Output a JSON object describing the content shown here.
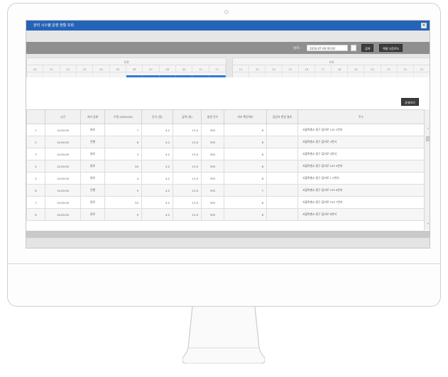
{
  "window": {
    "title": "관리 시스템 운영 현황 조회",
    "close_label": "×"
  },
  "toolbar": {
    "date_label": "일자 :",
    "date_value": "2016-07-00 00:00",
    "search_button": "검색",
    "excel_button": "엑셀 다운로드"
  },
  "schedule": {
    "left_title": "오전",
    "right_title": "오후",
    "left_hours": [
      "00",
      "01",
      "02",
      "03",
      "04",
      "05",
      "06",
      "07",
      "08",
      "09",
      "10",
      "11"
    ],
    "right_hours": [
      "12",
      "13",
      "14",
      "15",
      "16",
      "17",
      "18",
      "19",
      "20",
      "21",
      "22",
      "23"
    ],
    "active_left_slots": [
      6,
      7,
      8,
      9,
      10,
      11
    ]
  },
  "subbar": {
    "detail_button": "상세보기"
  },
  "table": {
    "headers": [
      "",
      "시간",
      "처리 상태",
      "수량 (kWh/kW)",
      "단가 (원)",
      "금액 (원)",
      "발생 건수",
      "처리 확인여부",
      "담당자 변경 결과",
      "주소"
    ],
    "rows": [
      [
        "1",
        "14:00:00",
        "완료",
        "7",
        "4.2",
        "13.0",
        "395",
        "8",
        "서울특별시 중구 을지로 140 1번지"
      ],
      [
        "2",
        "14:00:00",
        "진행",
        "8",
        "4.2",
        "13.0",
        "395",
        "8",
        "서울특별시 중구 을지로 2번지"
      ],
      [
        "3",
        "14:00:00",
        "완료",
        "3",
        "4.2",
        "13.0",
        "395",
        "8",
        "서울특별시 중구 을지로 3번지"
      ],
      [
        "4",
        "14:00:00",
        "완료",
        "50",
        "4.2",
        "13.0",
        "395",
        "8",
        "서울특별시 중구 을지로 240 4번지"
      ],
      [
        "5",
        "14:00:00",
        "완료",
        "4",
        "4.2",
        "13.0",
        "395",
        "8",
        "서울특별시 중구 을지로 1 5번지"
      ],
      [
        "6",
        "14:00:00",
        "진행",
        "9",
        "4.2",
        "13.0",
        "395",
        "7",
        "서울특별시 중구 을지로 230 6번지"
      ],
      [
        "7",
        "14:00:00",
        "완료",
        "50",
        "4.2",
        "13.0",
        "395",
        "8",
        "서울특별시 중구 을지로 230 7번지"
      ],
      [
        "8",
        "14:00:00",
        "완료",
        "9",
        "4.2",
        "13.0",
        "395",
        "8",
        "서울특별시 중구 을지로 8번지"
      ]
    ]
  },
  "colors": {
    "titlebar": "#2563b8",
    "active_slot": "#2f7bd4",
    "toolbar": "#8f8f8f"
  },
  "icons": {
    "close": "close-icon",
    "calendar": "calendar-icon",
    "scroll_up": "chevron-up-icon",
    "scroll_down": "chevron-down-icon"
  }
}
